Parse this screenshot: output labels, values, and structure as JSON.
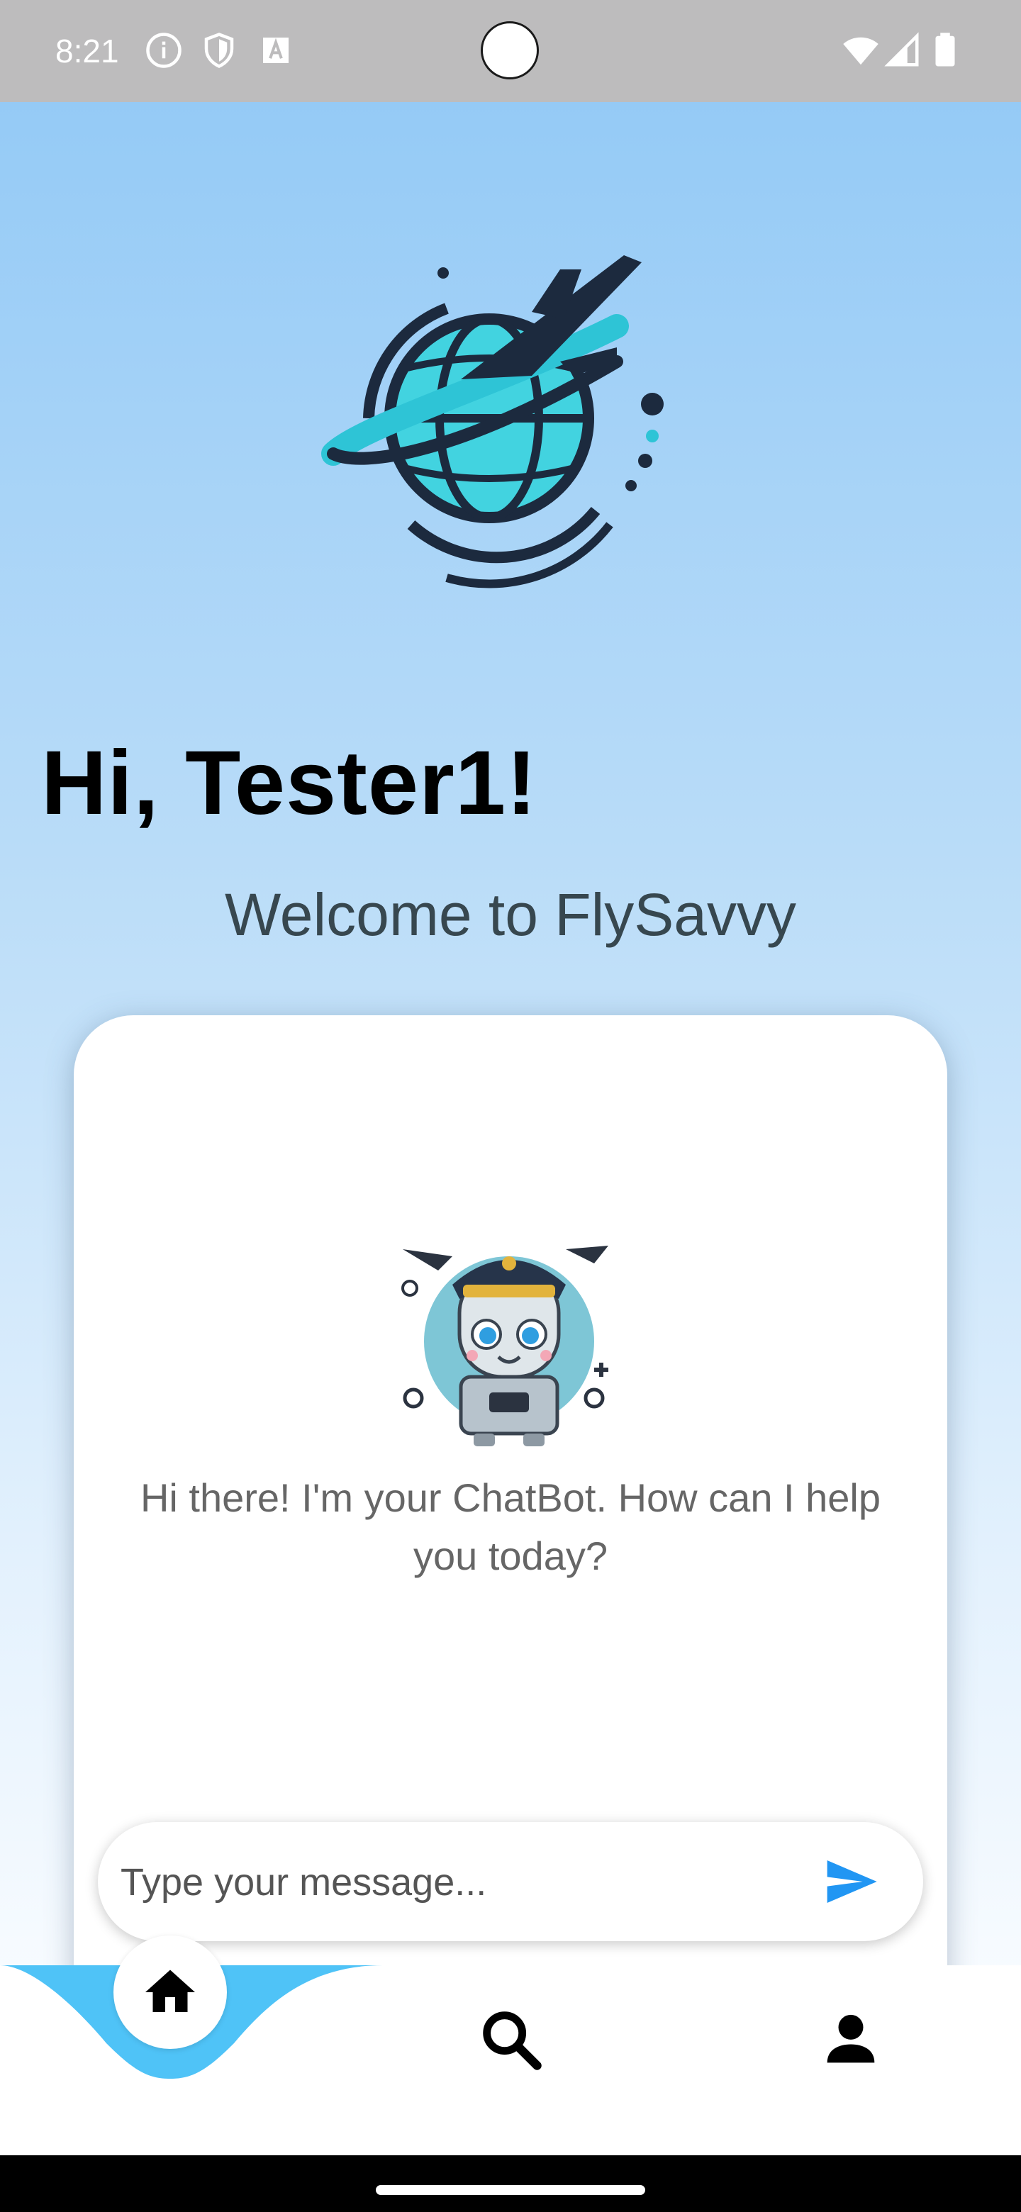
{
  "status_bar": {
    "time": "8:21",
    "left_icons": [
      "info-icon",
      "shield-icon",
      "a-box-icon"
    ],
    "right_icons": [
      "wifi-icon",
      "signal-icon",
      "battery-icon"
    ]
  },
  "app": {
    "logo_icon": "globe-airplane-logo",
    "greeting": "Hi, Tester1!",
    "welcome": "Welcome to FlySavvy"
  },
  "chat": {
    "bot_avatar": "robot-pilot-avatar",
    "bot_message": "Hi there! I'm your ChatBot. How can I help you today?",
    "input_placeholder": "Type your message...",
    "input_value": "",
    "send_icon": "send-icon"
  },
  "bottom_nav": {
    "items": [
      {
        "icon": "home-icon",
        "active": true
      },
      {
        "icon": "search-icon",
        "active": false
      },
      {
        "icon": "person-icon",
        "active": false
      }
    ]
  },
  "colors": {
    "gradient_top": "#90c8f6",
    "gradient_bottom": "#f7fbff",
    "accent": "#2196f3",
    "nav_wave": "#4fc3f7",
    "logo_dark": "#1c2a3e",
    "logo_teal": "#2ec4d6"
  }
}
